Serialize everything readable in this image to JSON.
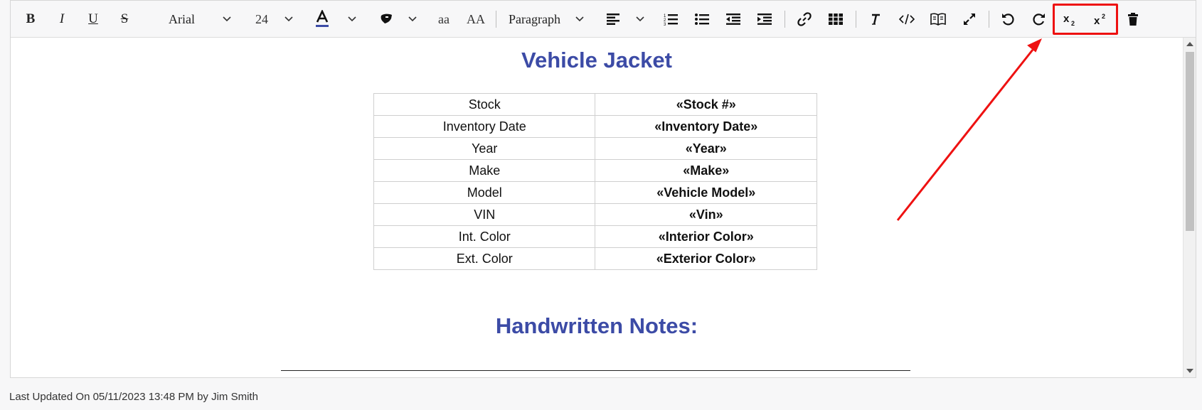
{
  "toolbar": {
    "font_family": "Arial",
    "font_size": "24",
    "lowercase_label": "aa",
    "uppercase_label": "AA",
    "block_format": "Paragraph",
    "highlight_color": "#ee1111"
  },
  "document": {
    "title": "Vehicle Jacket",
    "rows": [
      {
        "label": "Stock",
        "value": "«Stock #»"
      },
      {
        "label": "Inventory Date",
        "value": "«Inventory Date»"
      },
      {
        "label": "Year",
        "value": "«Year»"
      },
      {
        "label": "Make",
        "value": "«Make»"
      },
      {
        "label": "Model",
        "value": "«Vehicle Model»"
      },
      {
        "label": "VIN",
        "value": "«Vin»"
      },
      {
        "label": "Int. Color",
        "value": "«Interior Color»"
      },
      {
        "label": "Ext. Color",
        "value": "«Exterior Color»"
      }
    ],
    "notes_heading": "Handwritten Notes:"
  },
  "footer": {
    "last_updated": "Last Updated On 05/11/2023 13:48 PM by Jim Smith"
  }
}
